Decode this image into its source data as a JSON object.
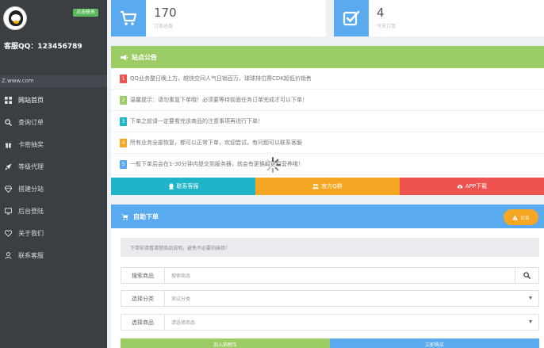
{
  "colors": {
    "sidebar_bg": "#3a3f44",
    "blue": "#5aaaf0",
    "green": "#9ccc65",
    "cyan": "#1fb5c9",
    "orange": "#f5a623",
    "red": "#ef5350"
  },
  "sidebar": {
    "contact_badge": "点击联系",
    "service_qq": "客服QQ：123456789",
    "url": "Z.www.com",
    "items": [
      {
        "label": "网站首页",
        "icon": "grid-icon"
      },
      {
        "label": "查询订单",
        "icon": "search-icon"
      },
      {
        "label": "卡密抽奖",
        "icon": "gift-icon"
      },
      {
        "label": "等级代理",
        "icon": "rocket-icon"
      },
      {
        "label": "搭建分站",
        "icon": "diamond-icon"
      },
      {
        "label": "后台登陆",
        "icon": "monitor-icon"
      },
      {
        "label": "关于我们",
        "icon": "heart-icon"
      },
      {
        "label": "联系客服",
        "icon": "user-icon"
      }
    ]
  },
  "stats": [
    {
      "value": "170",
      "label": "订单总数",
      "icon": "cart-icon"
    },
    {
      "value": "4",
      "label": "今天订单",
      "icon": "checkbox-icon"
    }
  ],
  "announcement": {
    "title": "站点公告",
    "items": [
      {
        "n": "1",
        "text": "QQ业务整日晚上方，越快空间人气日销百万，球球排位赛CDK超低价销售"
      },
      {
        "n": "2",
        "text": "温馨提示：请勿重复下单哦！必须要等待前面任务订单完成才可以下单！"
      },
      {
        "n": "3",
        "text": "下单之前请一定要看完该商品的注意事项再进行下单！"
      },
      {
        "n": "4",
        "text": "所有业务全部恢复，都可以正常下单，欢迎尝试，有问题可以联系客服"
      },
      {
        "n": "5",
        "text": "一般下单后会在1-30分钟内提交到服务器，就会有更换的更稳营养哦！"
      }
    ],
    "badge_colors": [
      "#ef5350",
      "#9ccc65",
      "#1fb5c9",
      "#f5a623",
      "#5aaaf0"
    ],
    "buttons": [
      {
        "label": "联系客服",
        "icon": "qq-icon",
        "color": "#1fb5c9"
      },
      {
        "label": "官方Q群",
        "icon": "group-icon",
        "color": "#f5a623"
      },
      {
        "label": "APP下载",
        "icon": "cloud-download-icon",
        "color": "#ef5350"
      }
    ]
  },
  "order": {
    "title": "自助下单",
    "notice_btn": "公告",
    "tip": "下单前请看清楚商品说明，避免不必要的麻烦！",
    "search_label": "搜索商品",
    "search_placeholder": "搜索商品",
    "category_label": "选择分类",
    "category_value": "测试分类",
    "product_label": "选择商品",
    "product_value": "请选择商品",
    "add_cart": "加入购物车",
    "buy_now": "立即购买",
    "add_cart_color": "#9ccc65",
    "buy_now_color": "#5aaaf0"
  }
}
